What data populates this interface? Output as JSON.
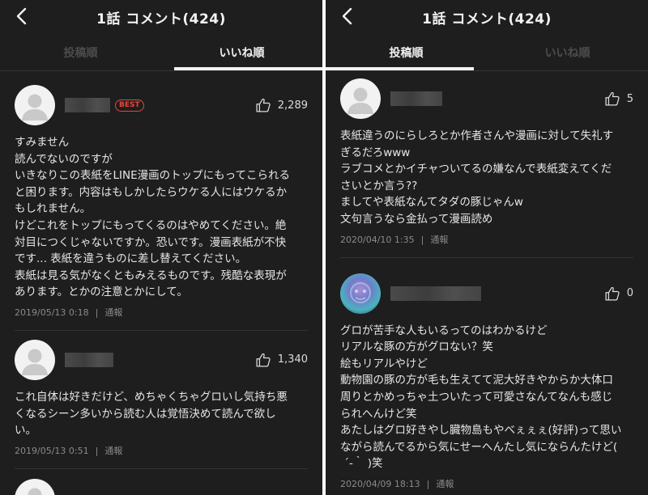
{
  "left": {
    "title": "1話 コメント(424)",
    "tabs": [
      "投稿順",
      "いいね順"
    ],
    "comments": [
      {
        "best": "BEST",
        "likes": "2,289",
        "body": "すみません\n読んでないのですが\nいきなりこの表紙をLINE漫画のトップにもってこられる\nと困ります。内容はもしかしたらウケる人にはウケるか\nもしれません。\nけどこれをトップにもってくるのはやめてください。絶\n対目につくじゃないですか。恐いです。漫画表紙が不快\nです... 表紙を違うものに差し替えてください。\n表紙は見る気がなくともみえるものです。残酷な表現が\nあります。とかの注意とかにして。",
        "date": "2019/05/13 0:18",
        "report": "通報"
      },
      {
        "likes": "1,340",
        "body": "これ自体は好きだけど、めちゃくちゃグロいし気持ち悪\nくなるシーン多いから読む人は覚悟決めて読んで欲し\nい。",
        "date": "2019/05/13 0:51",
        "report": "通報"
      }
    ]
  },
  "right": {
    "title": "1話 コメント(424)",
    "tabs": [
      "投稿順",
      "いいね順"
    ],
    "comments": [
      {
        "likes": "5",
        "body": "表紙違うのにらしろとか作者さんや漫画に対して失礼す\nぎるだろwww\nラブコメとかイチャついてるの嫌なんで表紙変えてくだ\nさいとか言う??\nましてや表紙なんてタダの豚じゃんw\n文句言うなら金払って漫画読め",
        "date": "2020/04/10 1:35",
        "report": "通報"
      },
      {
        "likes": "0",
        "body": "グロが苦手な人もいるってのはわかるけど\nリアルな豚の方がグロない？笑\n絵もリアルやけど\n動物園の豚の方が毛も生えてて泥大好きやからか大体口\n周りとかめっちゃ土ついたって可愛さなんてなんも感じ\nられへんけど笑\nあたしはグロ好きやし臓物島もやべぇぇぇ(好評)って思い\nながら読んでるから気にせーへんたし気にならんたけど(\n ´-｀ )笑",
        "date": "2020/04/09 18:13",
        "report": "通報"
      }
    ]
  }
}
